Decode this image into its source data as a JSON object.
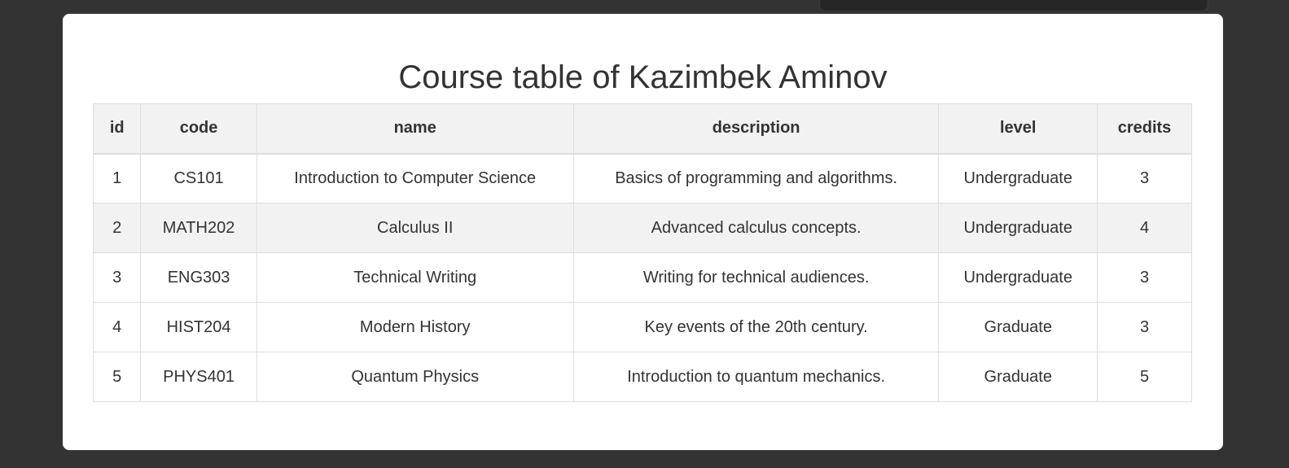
{
  "page": {
    "title": "Course table of Kazimbek Aminov"
  },
  "table": {
    "headers": [
      "id",
      "code",
      "name",
      "description",
      "level",
      "credits"
    ],
    "rows": [
      [
        "1",
        "CS101",
        "Introduction to Computer Science",
        "Basics of programming and algorithms.",
        "Undergraduate",
        "3"
      ],
      [
        "2",
        "MATH202",
        "Calculus II",
        "Advanced calculus concepts.",
        "Undergraduate",
        "4"
      ],
      [
        "3",
        "ENG303",
        "Technical Writing",
        "Writing for technical audiences.",
        "Undergraduate",
        "3"
      ],
      [
        "4",
        "HIST204",
        "Modern History",
        "Key events of the 20th century.",
        "Graduate",
        "3"
      ],
      [
        "5",
        "PHYS401",
        "Quantum Physics",
        "Introduction to quantum mechanics.",
        "Graduate",
        "5"
      ]
    ]
  },
  "colors": {
    "background": "#333333",
    "card": "#ffffff",
    "header_bg": "#f2f2f2",
    "alt_row_bg": "#f2f2f2",
    "border": "#dddddd",
    "text": "#333333"
  }
}
